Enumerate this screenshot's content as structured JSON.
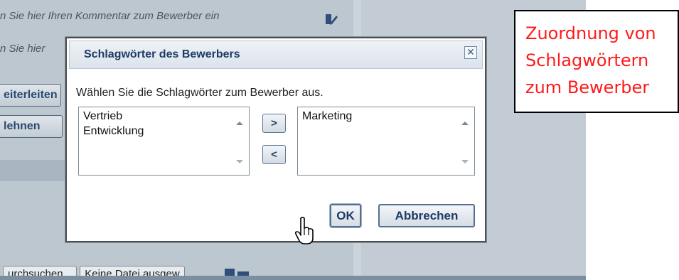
{
  "background": {
    "comment_line1": "n Sie hier Ihren Kommentar zum Bewerber ein",
    "comment_line2": "n Sie hier",
    "forward_button": "eiterleiten",
    "reject_button": "lehnen",
    "upload_browse": "urchsuchen...",
    "upload_status": "Keine Datei ausgew"
  },
  "dialog": {
    "title": "Schlagwörter des Bewerbers",
    "close_glyph": "✕",
    "instruction": "Wählen Sie die Schlagwörter zum Bewerber aus.",
    "available": [
      "Vertrieb",
      "Entwicklung"
    ],
    "selected": [
      "Marketing"
    ],
    "move_right_label": ">",
    "move_left_label": "<",
    "ok_label": "OK",
    "cancel_label": "Abbrechen"
  },
  "callout": {
    "line1": "Zuordnung von",
    "line2": "Schlagwörtern",
    "line3": "zum Bewerber"
  },
  "colors": {
    "callout_text": "#ff1a1a",
    "dialog_title": "#1d3a66",
    "overlay_bg": "#bec8d1"
  }
}
